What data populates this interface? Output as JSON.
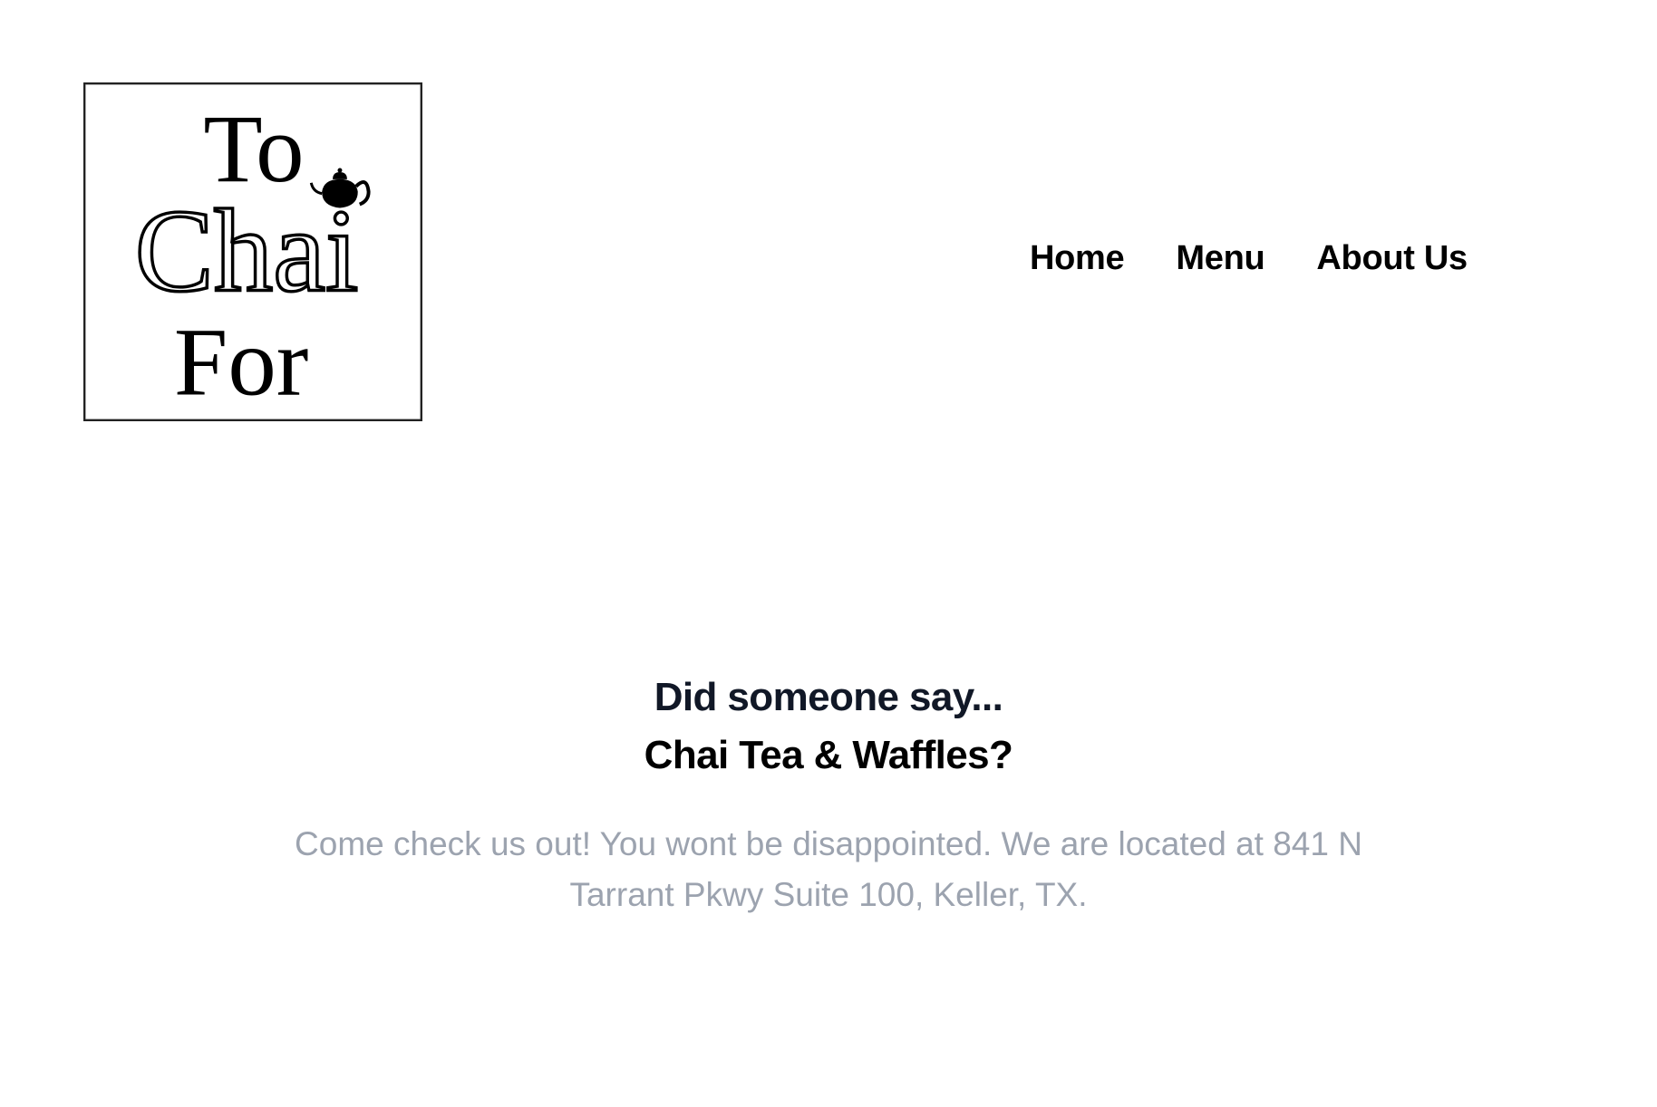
{
  "logo": {
    "line1": "To",
    "line2": "Chai",
    "line3": "For",
    "icon": "teapot-icon"
  },
  "nav": {
    "items": [
      {
        "label": "Home"
      },
      {
        "label": "Menu"
      },
      {
        "label": "About Us"
      }
    ]
  },
  "hero": {
    "heading_line1": "Did someone say...",
    "heading_line2": "Chai Tea & Waffles?",
    "description": "Come check us out! You wont be disappointed. We are located at 841 N Tarrant Pkwy Suite 100, Keller, TX."
  },
  "colors": {
    "heading_primary": "#111827",
    "body_text": "#9ca3af",
    "background": "#ffffff"
  }
}
